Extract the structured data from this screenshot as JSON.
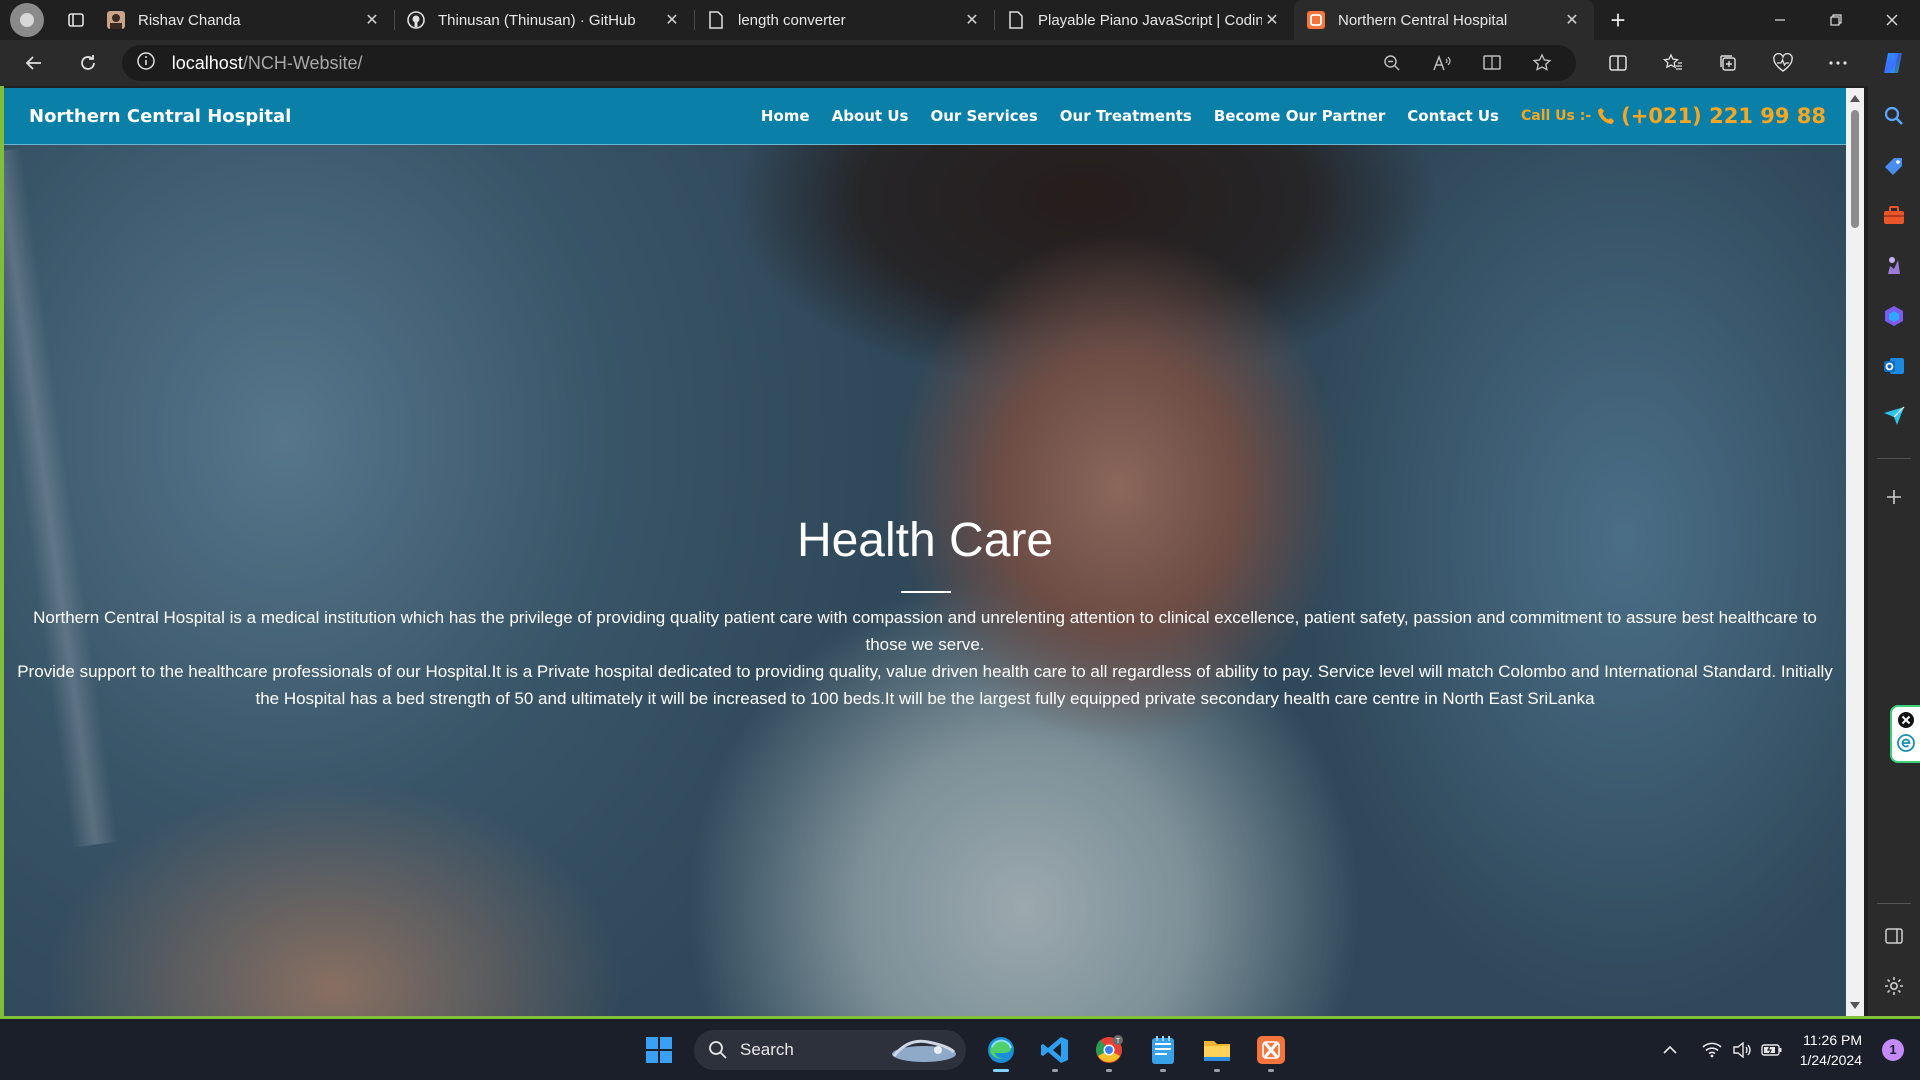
{
  "browser": {
    "tabs": [
      {
        "title": "Rishav Chanda",
        "icon": "avatar-icon"
      },
      {
        "title": "Thinusan (Thinusan) · GitHub",
        "icon": "github-icon"
      },
      {
        "title": "length converter",
        "icon": "page-icon"
      },
      {
        "title": "Playable Piano JavaScript | Codin",
        "icon": "page-icon"
      },
      {
        "title": "Northern Central Hospital",
        "icon": "html5-icon",
        "active": true
      }
    ],
    "url_host": "localhost",
    "url_path": "/NCH-Website/"
  },
  "site": {
    "brand": "Northern Central Hospital",
    "nav": [
      "Home",
      "About Us",
      "Our Services",
      "Our Treatments",
      "Become Our Partner",
      "Contact Us"
    ],
    "call_label": "Call Us :-",
    "phone": "(+021) 221 99 88",
    "accent_color": "#0a7fa8",
    "call_color": "#f5a623"
  },
  "hero": {
    "title": "Health Care",
    "paragraph_1": "Northern Central Hospital is a medical institution which has the privilege of providing quality patient care with compassion and unrelenting attention to clinical excellence, patient safety, passion and commitment to assure best healthcare to those we serve.",
    "paragraph_2": "Provide support to the healthcare professionals of our Hospital.It is a Private hospital dedicated to providing quality, value driven health care to all regardless of ability to pay. Service level will match Colombo and International Standard. Initially the Hospital has a bed strength of 50 and ultimately it will be increased to 100 beds.It will be the largest fully equipped private secondary health care centre in North East SriLanka"
  },
  "taskbar": {
    "search_label": "Search",
    "time": "11:26 PM",
    "date": "1/24/2024",
    "notification_count": "1"
  }
}
